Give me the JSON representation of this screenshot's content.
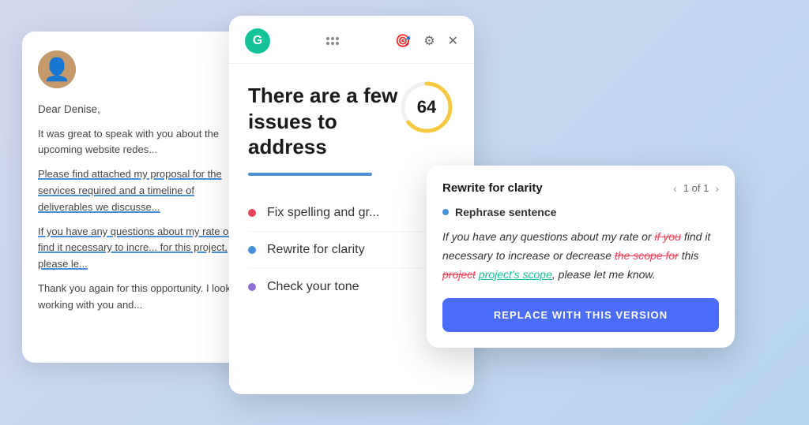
{
  "background": {
    "gradient_start": "#d4d8f0",
    "gradient_end": "#b8d4ee"
  },
  "email_card": {
    "greeting": "Dear Denise,",
    "paragraph1": "It was great to speak with you about the upcoming website redes...",
    "paragraph2": "Please find attached my proposal for the services required and a timeline of deliverables we discusse...",
    "paragraph3": "If you have any questions about my rate or find it necessary to incre... for this project, please le...",
    "paragraph4": "Thank you again for this opportunity. I look to working with you and..."
  },
  "grammarly_panel": {
    "logo_letter": "G",
    "title": "There are a few issues to address",
    "score": "64",
    "issues": [
      {
        "label": "Fix spelling and gr...",
        "dot_color": "red"
      },
      {
        "label": "Rewrite for clarity",
        "dot_color": "blue"
      },
      {
        "label": "Check your tone",
        "dot_color": "purple"
      }
    ]
  },
  "rewrite_card": {
    "title": "Rewrite for clarity",
    "nav_text": "1 of 1",
    "sub_label": "Rephrase sentence",
    "text_parts": {
      "before": "If you have any questions about my rate or ",
      "strikethrough1": "if you",
      "middle1": " find it necessary to increase or decrease ",
      "strikethrough2": "the scope for",
      "middle2": " this ",
      "strikethrough3": "project",
      "green": "project's scope",
      "after": ", please let me know."
    },
    "button_label": "REPLACE WITH THIS VERSION"
  },
  "icons": {
    "target_icon": "⊕",
    "settings_icon": "⚙",
    "close_icon": "✕",
    "dots_icon": "⠿"
  }
}
